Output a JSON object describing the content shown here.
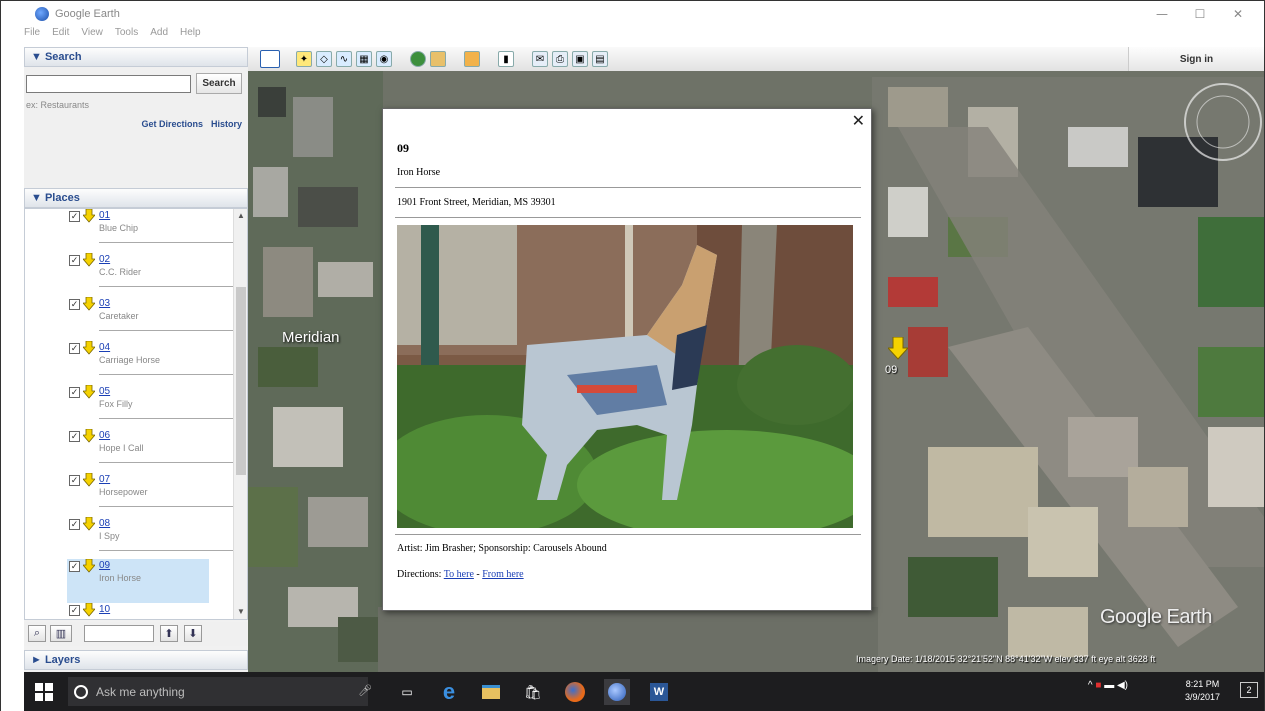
{
  "window": {
    "title": "Google Earth",
    "controls": [
      "—",
      "☐",
      "✕"
    ]
  },
  "menu": [
    "File",
    "Edit",
    "View",
    "Tools",
    "Add",
    "Help"
  ],
  "search_panel": {
    "header": "▼ Search",
    "button": "Search",
    "placeholder": "",
    "hint": "ex: Restaurants",
    "get_directions": "Get Directions",
    "history": "History"
  },
  "places_panel": {
    "header": "▼ Places",
    "items": [
      {
        "num": "01",
        "name": "Blue Chip",
        "selected": false
      },
      {
        "num": "02",
        "name": "C.C. Rider",
        "selected": false
      },
      {
        "num": "03",
        "name": "Caretaker",
        "selected": false
      },
      {
        "num": "04",
        "name": "Carriage Horse",
        "selected": false
      },
      {
        "num": "05",
        "name": "Fox Filly",
        "selected": false
      },
      {
        "num": "06",
        "name": "Hope I Call",
        "selected": false
      },
      {
        "num": "07",
        "name": "Horsepower",
        "selected": false
      },
      {
        "num": "08",
        "name": "I Spy",
        "selected": false
      },
      {
        "num": "09",
        "name": "Iron Horse",
        "selected": true
      },
      {
        "num": "10",
        "name": "",
        "selected": false
      }
    ]
  },
  "layers_panel": {
    "header": "► Layers"
  },
  "signin": "Sign in",
  "map": {
    "city_label": "Meridian",
    "pin_label": "09",
    "logo": "Google Earth",
    "status": "Imagery Date: 1/18/2015   32°21'52\"N  88°41'32\"W   elev  337 ft     eye alt  3628 ft"
  },
  "balloon": {
    "num": "09",
    "name": "Iron Horse",
    "address": "1901 Front Street, Meridian, MS 39301",
    "credit": "Artist: Jim Brasher; Sponsorship: Carousels Abound",
    "directions_label": "Directions:",
    "to_here": "To here",
    "separator": " - ",
    "from_here": "From here"
  },
  "taskbar": {
    "search_placeholder": "Ask me anything",
    "time": "8:21 PM",
    "date": "3/9/2017"
  },
  "colors": {
    "link": "#1a3fb5",
    "panel_header": "#2a4d8f",
    "selected_row": "#cde4f7",
    "taskbar": "#1d1d1f",
    "pin": "#f5d200"
  }
}
